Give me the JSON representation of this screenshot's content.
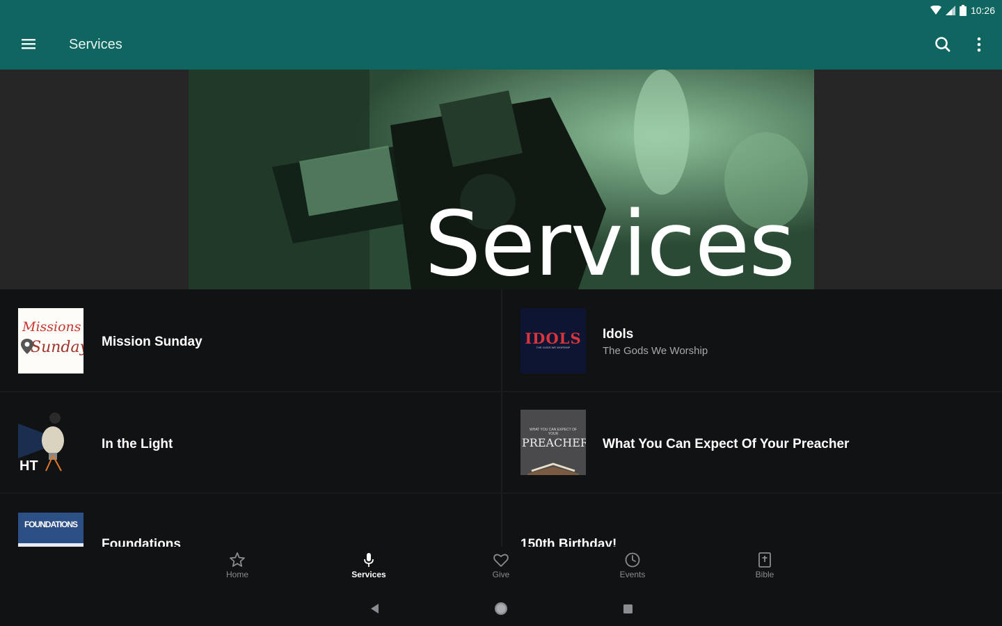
{
  "status_bar": {
    "time": "10:26"
  },
  "app_bar": {
    "title": "Services",
    "menu_icon": "hamburger-menu-icon",
    "search_icon": "search-icon",
    "more_icon": "more-vertical-icon"
  },
  "hero": {
    "text": "Services"
  },
  "colors": {
    "app_bar": "#0f6661",
    "background": "#111214",
    "hero_tint": "#2b4a35",
    "accent": "#d8353c"
  },
  "services": [
    {
      "title": "Mission Sunday",
      "subtitle": "",
      "thumb_text_1": "Missions",
      "thumb_text_2": "Sunday"
    },
    {
      "title": "Idols",
      "subtitle": "The Gods We Worship",
      "thumb_text": "IDOLS",
      "thumb_small": "THE GODS WE WORSHIP"
    },
    {
      "title": "In the Light",
      "subtitle": "",
      "thumb_text": "HT"
    },
    {
      "title": "What You Can Expect Of Your Preacher",
      "subtitle": "",
      "thumb_text": "PREACHER",
      "thumb_small": "WHAT YOU CAN EXPECT OF YOUR"
    },
    {
      "title": "Foundations",
      "subtitle": "",
      "thumb_text": "FOUNDATIONS"
    },
    {
      "title": "150th Birthday!",
      "subtitle": ""
    }
  ],
  "bottom_nav": [
    {
      "label": "Home",
      "icon": "star-icon",
      "active": false
    },
    {
      "label": "Services",
      "icon": "microphone-icon",
      "active": true
    },
    {
      "label": "Give",
      "icon": "heart-icon",
      "active": false
    },
    {
      "label": "Events",
      "icon": "clock-icon",
      "active": false
    },
    {
      "label": "Bible",
      "icon": "bible-icon",
      "active": false
    }
  ],
  "system_nav": {
    "back_icon": "back-triangle-icon",
    "home_icon": "home-circle-icon",
    "recents_icon": "recents-square-icon"
  }
}
